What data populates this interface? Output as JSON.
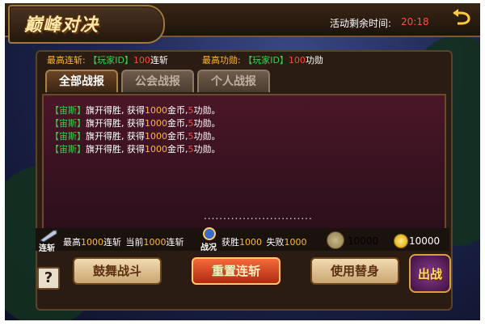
{
  "header": {
    "title": "巅峰对决",
    "timer_label": "活动剩余时间:",
    "timer_value": "20:18"
  },
  "stats": {
    "streak_label": "最高连斩:",
    "streak_player": "【玩家ID】",
    "streak_value": "100",
    "streak_unit": "连斩",
    "merit_label": "最高功勋:",
    "merit_player": "【玩家ID】",
    "merit_value": "100",
    "merit_unit": "功勋"
  },
  "tabs": [
    {
      "label": "全部战报",
      "active": true
    },
    {
      "label": "公会战报",
      "active": false
    },
    {
      "label": "个人战报",
      "active": false
    }
  ],
  "log": [
    {
      "name": "【宙斯】",
      "a": "旗开得胜, 获得",
      "gold": "1000",
      "b": "金币,",
      "merit": "5",
      "c": "功勋。"
    },
    {
      "name": "【宙斯】",
      "a": "旗开得胜, 获得",
      "gold": "1000",
      "b": "金币,",
      "merit": "5",
      "c": "功勋。"
    },
    {
      "name": "【宙斯】",
      "a": "旗开得胜, 获得",
      "gold": "1000",
      "b": "金币,",
      "merit": "5",
      "c": "功勋。"
    },
    {
      "name": "【宙斯】",
      "a": "旗开得胜, 获得",
      "gold": "1000",
      "b": "金币,",
      "merit": "5",
      "c": "功勋。"
    }
  ],
  "dots": "............................",
  "bar": {
    "streak_icon_label": "连斩",
    "max_label": "最高",
    "max_value": "1000",
    "max_unit": "连斩",
    "cur_label": "当前",
    "cur_value": "1000",
    "cur_unit": "连斩",
    "war_icon_label": "战况",
    "win_label": "获胜",
    "win_value": "1000",
    "lose_label": "失败",
    "lose_value": "1000",
    "merit_coin_value": "10000",
    "gold_coin_value": "10000"
  },
  "buttons": {
    "help": "?",
    "encourage": "鼓舞战斗",
    "reset": "重置连斩",
    "substitute": "使用替身",
    "fight": "出战"
  }
}
